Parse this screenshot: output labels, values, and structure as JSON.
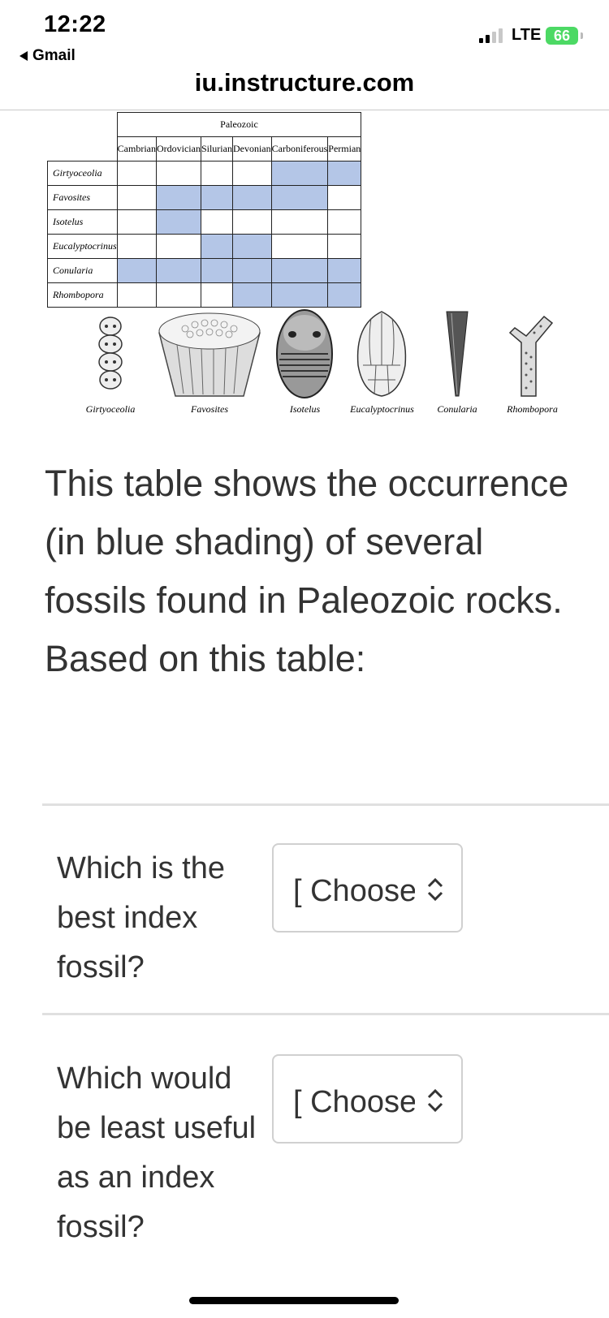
{
  "status_bar": {
    "time": "12:22",
    "back_label": "Gmail",
    "network": "LTE",
    "battery": "66"
  },
  "browser": {
    "url": "iu.instructure.com"
  },
  "fossil_table": {
    "era": "Paleozoic",
    "periods": [
      "Cambrian",
      "Ordovician",
      "Silurian",
      "Devonian",
      "Carboniferous",
      "Permian"
    ],
    "rows": [
      {
        "name": "Girtyoceolia",
        "occurrence": [
          0,
          0,
          0,
          0,
          1,
          1
        ]
      },
      {
        "name": "Favosites",
        "occurrence": [
          0,
          1,
          1,
          1,
          1,
          0
        ]
      },
      {
        "name": "Isotelus",
        "occurrence": [
          0,
          1,
          0,
          0,
          0,
          0
        ]
      },
      {
        "name": "Eucalyptocrinus",
        "occurrence": [
          0,
          0,
          1,
          1,
          0,
          0
        ]
      },
      {
        "name": "Conularia",
        "occurrence": [
          1,
          1,
          1,
          1,
          1,
          1
        ]
      },
      {
        "name": "Rhombopora",
        "occurrence": [
          0,
          0,
          0,
          1,
          1,
          1
        ]
      }
    ],
    "shade_color": "#b4c6e7"
  },
  "fossil_captions": [
    "Girtyoceolia",
    "Favosites",
    "Isotelus",
    "Eucalyptocrinus",
    "Conularia",
    "Rhombopora"
  ],
  "prose": "This table shows the occurrence (in blue shading) of several fossils found in Paleozoic rocks.  Based on this table:",
  "questions": [
    {
      "text": "Which is the best index fossil?",
      "select_value": "[ Choose ]"
    },
    {
      "text": "Which would be least useful as an index fossil?",
      "select_value": "[ Choose ]"
    }
  ]
}
